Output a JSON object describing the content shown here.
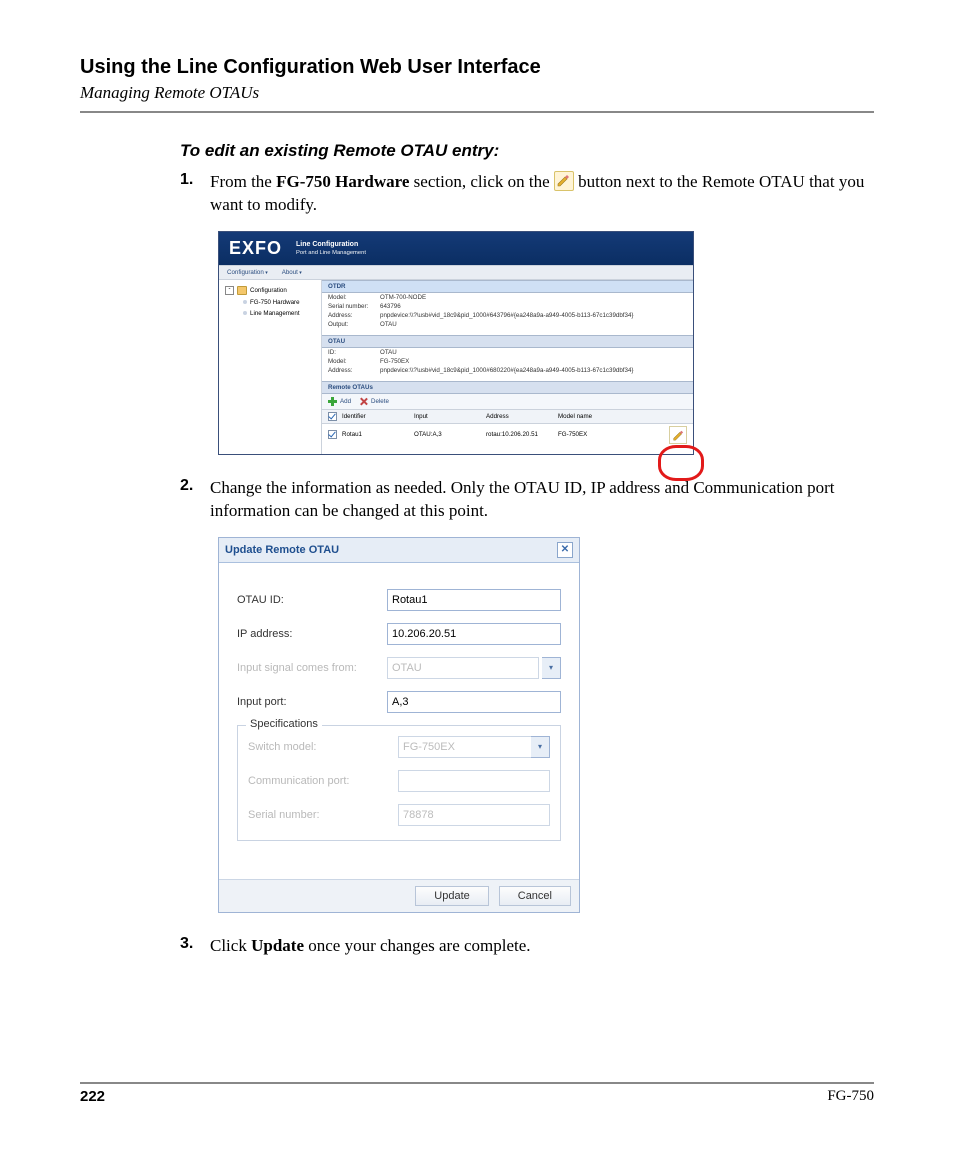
{
  "doc": {
    "chapter_title": "Using the Line Configuration Web User Interface",
    "section_title": "Managing Remote OTAUs",
    "sub_heading": "To edit an existing Remote OTAU entry:",
    "step1_a": "From the ",
    "step1_b": "FG-750 Hardware",
    "step1_c": " section, click on the ",
    "step1_d": " button next to the Remote OTAU that you want to modify.",
    "step2": "Change the information as needed. Only the OTAU ID, IP address and Communication port information can be changed at this point.",
    "step3_a": "Click ",
    "step3_b": "Update",
    "step3_c": " once your changes are complete.",
    "page_number": "222",
    "product": "FG-750"
  },
  "shot1": {
    "logo": "EXFO",
    "title": "Line Configuration",
    "subtitle": "Port and Line Management",
    "menu": {
      "configuration": "Configuration",
      "about": "About"
    },
    "nav": {
      "root": "Configuration",
      "hw": "FG-750 Hardware",
      "lm": "Line Management"
    },
    "otdr": {
      "heading": "OTDR",
      "model_l": "Model:",
      "model_v": "OTM-700-NODE",
      "serial_l": "Serial number:",
      "serial_v": "643796",
      "address_l": "Address:",
      "address_v": "pnpdevice:\\\\?\\usb#vid_18c9&pid_1000#643796#{ea248a9a-a949-4005-b113-67c1c39dbf34}",
      "output_l": "Output:",
      "output_v": "OTAU"
    },
    "otau": {
      "heading": "OTAU",
      "id_l": "ID:",
      "id_v": "OTAU",
      "model_l": "Model:",
      "model_v": "FG-750EX",
      "address_l": "Address:",
      "address_v": "pnpdevice:\\\\?\\usb#vid_18c9&pid_1000#680220#{ea248a9a-a949-4005-b113-67c1c39dbf34}"
    },
    "remote": {
      "heading": "Remote OTAUs",
      "add": "Add",
      "delete": "Delete",
      "cols": {
        "id": "Identifier",
        "input": "Input",
        "addr": "Address",
        "model": "Model name"
      },
      "row": {
        "id": "Rotau1",
        "input": "OTAU:A,3",
        "addr": "rotau:10.206.20.51",
        "model": "FG-750EX"
      }
    }
  },
  "shot2": {
    "title": "Update Remote OTAU",
    "labels": {
      "otau_id": "OTAU ID:",
      "ip": "IP address:",
      "signal_from": "Input signal comes from:",
      "input_port": "Input port:",
      "specs": "Specifications",
      "switch_model": "Switch model:",
      "comm_port": "Communication port:",
      "serial": "Serial number:"
    },
    "values": {
      "otau_id": "Rotau1",
      "ip": "10.206.20.51",
      "signal_from": "OTAU",
      "input_port": "A,3",
      "switch_model": "FG-750EX",
      "comm_port": "",
      "serial": "78878"
    },
    "buttons": {
      "update": "Update",
      "cancel": "Cancel"
    }
  }
}
